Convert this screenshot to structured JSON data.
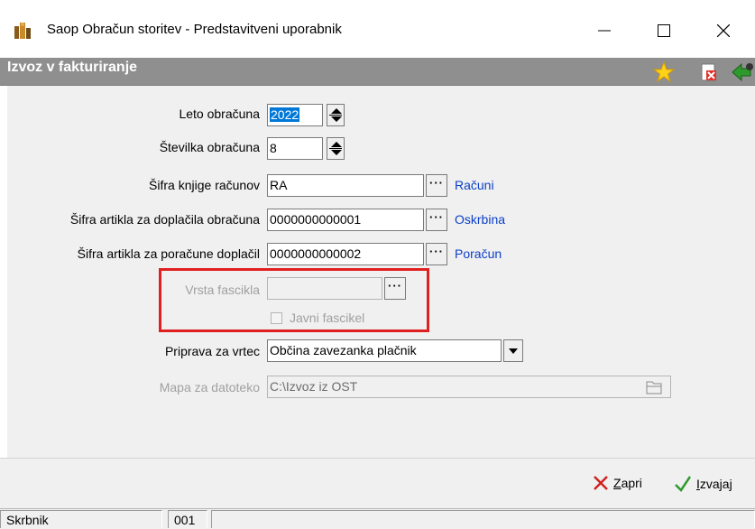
{
  "window": {
    "title": "Saop Obračun storitev - Predstavitveni uporabnik",
    "minimize_symbol": "—",
    "maximize_symbol": "☐",
    "close_symbol": "✕"
  },
  "header": {
    "title": "Izvoz v fakturiranje",
    "icons": [
      "star-icon",
      "pdf-close-icon",
      "exit-icon"
    ]
  },
  "form": {
    "leto": {
      "label": "Leto obračuna",
      "value": "2022"
    },
    "stevilka": {
      "label": "Številka obračuna",
      "value": "8"
    },
    "knjiga": {
      "label": "Šifra knjige računov",
      "value": "RA",
      "link": "Računi"
    },
    "doplacila": {
      "label": "Šifra artikla za doplačila obračuna",
      "value": "0000000000001",
      "link": "Oskrbina"
    },
    "poracune": {
      "label": "Šifra artikla za poračune doplačil",
      "value": "0000000000002",
      "link": "Poračun"
    },
    "vrsta": {
      "label": "Vrsta fascikla",
      "value": ""
    },
    "javni": {
      "label": "Javni fascikel",
      "checked": false
    },
    "vrtec": {
      "label": "Priprava za vrtec",
      "value": "Občina zavezanka plačnik"
    },
    "mapa": {
      "label": "Mapa za datoteko",
      "value": "C:\\Izvoz iz OST"
    },
    "dots": "···"
  },
  "buttons": {
    "zapri": {
      "first": "Z",
      "rest": "apri"
    },
    "izvajaj": {
      "first": "I",
      "rest": "zvajaj"
    }
  },
  "statusbar": {
    "user": "Skrbnik",
    "code": "001"
  },
  "colors": {
    "header_bg": "#8f8f8f",
    "link": "#0a3fc7",
    "highlight": "#e02020"
  }
}
